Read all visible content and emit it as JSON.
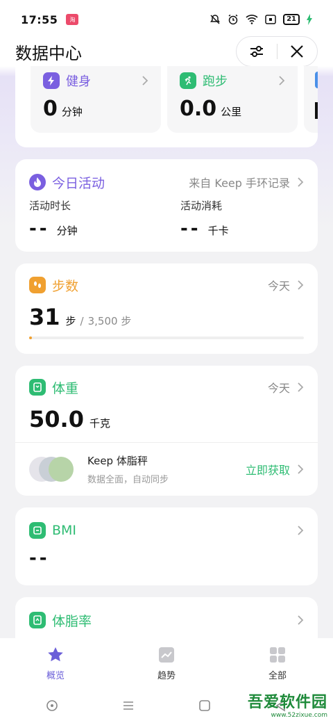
{
  "status_bar": {
    "time": "17:55",
    "app_badge": "淘",
    "battery": "21"
  },
  "header": {
    "title": "数据中心",
    "filter_icon": "sliders-icon",
    "close_icon": "close-icon"
  },
  "sports": {
    "tiles": [
      {
        "label": "健身",
        "value": "0",
        "unit": "分钟",
        "color": "#7a5fe0"
      },
      {
        "label": "跑步",
        "value": "0.0",
        "unit": "公里",
        "color": "#2ebc73"
      }
    ]
  },
  "activity": {
    "title": "今日活动",
    "source": "来自 Keep 手环记录",
    "duration_label": "活动时长",
    "duration_value": "--",
    "duration_unit": "分钟",
    "calories_label": "活动消耗",
    "calories_value": "--",
    "calories_unit": "千卡",
    "color": "#7a5fe0"
  },
  "steps": {
    "title": "步数",
    "period": "今天",
    "value": "31",
    "unit": "步",
    "separator": "/",
    "goal": "3,500 步",
    "progress": 0.009,
    "color": "#f0a030"
  },
  "weight": {
    "title": "体重",
    "period": "今天",
    "value": "50.0",
    "unit": "千克",
    "promo_title": "Keep 体脂秤",
    "promo_sub": "数据全面，自动同步",
    "promo_action": "立即获取",
    "color": "#2ebc73"
  },
  "bmi": {
    "title": "BMI",
    "value": "--",
    "color": "#2ebc73"
  },
  "body_fat": {
    "title": "体脂率",
    "color": "#2ebc73"
  },
  "bottom_nav": {
    "items": [
      {
        "label": "概览",
        "icon": "star-icon",
        "active": true
      },
      {
        "label": "趋势",
        "icon": "trend-icon",
        "active": false
      },
      {
        "label": "全部",
        "icon": "grid-icon",
        "active": false
      }
    ]
  },
  "watermark": {
    "big": "吾爱软件园",
    "small": "www.52zixue.com"
  },
  "colors": {
    "accent": "#6a5ed8",
    "green": "#2ebc73",
    "orange": "#f0a030"
  }
}
